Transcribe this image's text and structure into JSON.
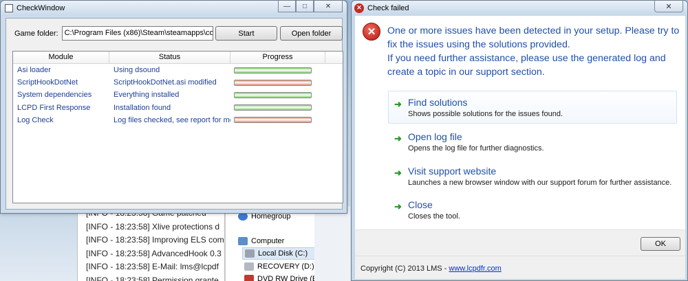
{
  "background": {
    "log_lines": [
      "[INFO - 18:23:58] Game patched",
      "[INFO - 18:23:58] Xlive protections d",
      "[INFO - 18:23:58] Improving ELS com",
      "[INFO - 18:23:58] AdvancedHook 0.3",
      "[INFO - 18:23:58] E-Mail: lms@lcpdf",
      "[INFO - 18:23:58] Permission grante"
    ],
    "explorer_items": [
      {
        "label": "Homegroup",
        "icon": "homegroup-icon"
      },
      {
        "label": "Computer",
        "icon": "computer-icon"
      },
      {
        "label": "Local Disk (C:)",
        "icon": "hard-drive-icon"
      },
      {
        "label": "RECOVERY (D:)",
        "icon": "drive-icon"
      },
      {
        "label": "DVD RW Drive (E:)",
        "icon": "dvd-drive-icon"
      }
    ]
  },
  "check_window": {
    "title": "CheckWindow",
    "folder_label": "Game folder:",
    "folder_value": "C:\\Program Files (x86)\\Steam\\steamapps\\co",
    "start_label": "Start",
    "open_folder_label": "Open folder",
    "columns": {
      "module": "Module",
      "status": "Status",
      "progress": "Progress"
    },
    "rows": [
      {
        "module": "Asi loader",
        "status": "Using dsound",
        "progress": 1.0,
        "state": "ok"
      },
      {
        "module": "ScriptHookDotNet",
        "status": "ScriptHookDotNet.asi modified",
        "progress": 1.0,
        "state": "error"
      },
      {
        "module": "System dependencies",
        "status": "Everything installed",
        "progress": 1.0,
        "state": "ok"
      },
      {
        "module": "LCPD First Response",
        "status": "Installation found",
        "progress": 1.0,
        "state": "ok"
      },
      {
        "module": "Log Check",
        "status": "Log files checked, see report for mo",
        "progress": 1.0,
        "state": "error"
      }
    ],
    "colors": {
      "ok": "#7fcf6a",
      "error": "#e38a6c"
    }
  },
  "failed_dialog": {
    "title": "Check failed",
    "message_lines": [
      "One or more issues have been detected in your setup. Please try to fix the issues using the solutions provided.",
      "If you need further assistance, please use the generated log and create a topic in our support section."
    ],
    "options": [
      {
        "title": "Find solutions",
        "desc": "Shows possible solutions for the issues found."
      },
      {
        "title": "Open log file",
        "desc": "Opens the log file for further diagnostics."
      },
      {
        "title": "Visit support website",
        "desc": "Launches a new browser window with our support forum for further assistance."
      },
      {
        "title": "Close",
        "desc": "Closes the tool."
      }
    ],
    "ok_label": "OK",
    "footer_text": "Copyright (C) 2013 LMS - ",
    "footer_link": "www.lcpdfr.com"
  }
}
